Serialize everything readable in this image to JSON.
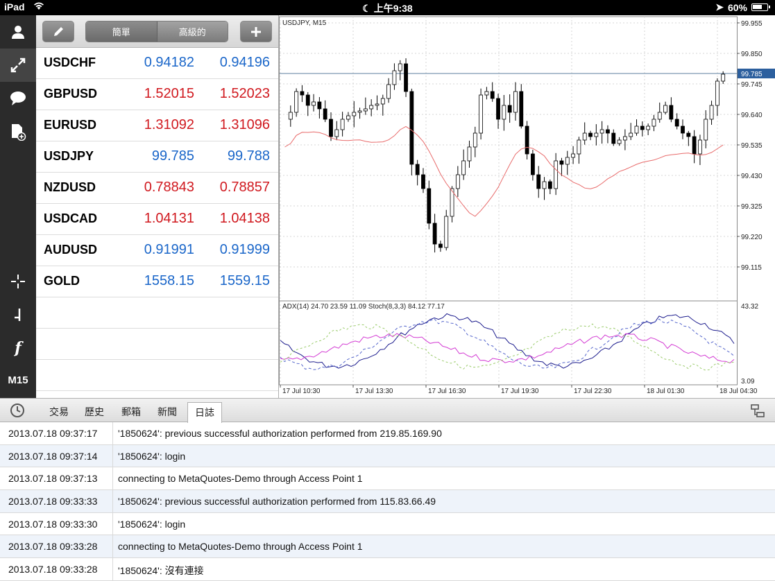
{
  "status_bar": {
    "device": "iPad",
    "time": "上午9:38",
    "battery": "60%",
    "battery_level": 0.6
  },
  "toolbar": {
    "timeframe": "M15",
    "segment": [
      "簡單",
      "高級的"
    ]
  },
  "quotes": [
    {
      "symbol": "USDCHF",
      "bid": "0.94182",
      "ask": "0.94196",
      "color": "#1a66c9"
    },
    {
      "symbol": "GBPUSD",
      "bid": "1.52015",
      "ask": "1.52023",
      "color": "#d0181e"
    },
    {
      "symbol": "EURUSD",
      "bid": "1.31092",
      "ask": "1.31096",
      "color": "#d0181e"
    },
    {
      "symbol": "USDJPY",
      "bid": "99.785",
      "ask": "99.788",
      "color": "#1a66c9"
    },
    {
      "symbol": "NZDUSD",
      "bid": "0.78843",
      "ask": "0.78857",
      "color": "#d0181e"
    },
    {
      "symbol": "USDCAD",
      "bid": "1.04131",
      "ask": "1.04138",
      "color": "#d0181e"
    },
    {
      "symbol": "AUDUSD",
      "bid": "0.91991",
      "ask": "0.91999",
      "color": "#1a66c9"
    },
    {
      "symbol": "GOLD",
      "bid": "1558.15",
      "ask": "1559.15",
      "color": "#1a66c9"
    }
  ],
  "chart": {
    "title": "USDJPY, M15",
    "price_ticks": [
      "99.955",
      "99.850",
      "99.745",
      "99.640",
      "99.535",
      "99.430",
      "99.325",
      "99.220",
      "99.115"
    ],
    "current_price": "99.785",
    "indicator_label": "ADX(14) 24.70 23.59 11.09 Stoch(8,3,3) 84.12 77.17",
    "indicator_ticks": [
      "43.32",
      "3.09"
    ],
    "time_ticks": [
      "17 Jul 10:30",
      "17 Jul 13:30",
      "17 Jul 16:30",
      "17 Jul 19:30",
      "17 Jul 22:30",
      "18 Jul 01:30",
      "18 Jul 04:30"
    ]
  },
  "bottom_tabs": [
    "交易",
    "歷史",
    "郵箱",
    "新聞",
    "日誌"
  ],
  "journal": [
    {
      "time": "2013.07.18 09:37:17",
      "message": "'1850624': previous successful authorization performed from 219.85.169.90"
    },
    {
      "time": "2013.07.18 09:37:14",
      "message": "'1850624': login"
    },
    {
      "time": "2013.07.18 09:37:13",
      "message": "connecting to MetaQuotes-Demo through Access Point 1"
    },
    {
      "time": "2013.07.18 09:33:33",
      "message": "'1850624': previous successful authorization performed from 115.83.66.49"
    },
    {
      "time": "2013.07.18 09:33:30",
      "message": "'1850624': login"
    },
    {
      "time": "2013.07.18 09:33:28",
      "message": "connecting to MetaQuotes-Demo through Access Point 1"
    },
    {
      "time": "2013.07.18 09:33:28",
      "message": "'1850624': 沒有連接"
    }
  ]
}
